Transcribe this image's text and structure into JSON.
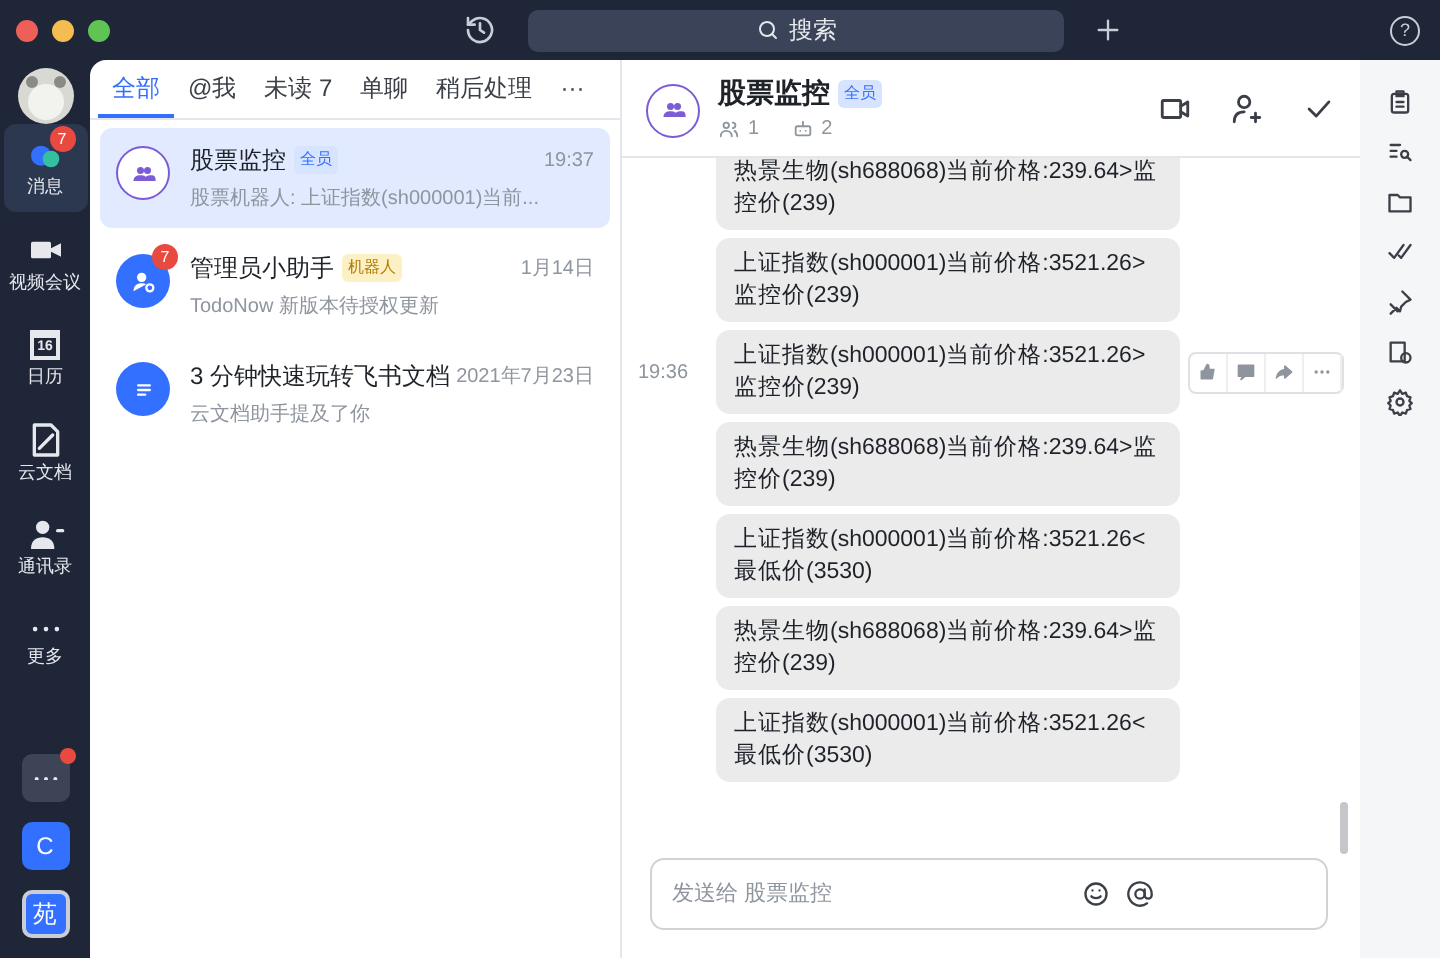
{
  "topbar": {
    "search": "搜索",
    "help": "?"
  },
  "rail": {
    "items": [
      {
        "label": "消息",
        "kind": "chat",
        "badge": "7",
        "selected": true
      },
      {
        "label": "视频会议",
        "kind": "video",
        "selected": false
      },
      {
        "label": "日历",
        "kind": "calendar",
        "day": "16",
        "selected": false
      },
      {
        "label": "云文档",
        "kind": "doc",
        "selected": false
      },
      {
        "label": "通讯录",
        "kind": "contacts",
        "selected": false
      },
      {
        "label": "更多",
        "kind": "more",
        "selected": false
      }
    ],
    "apps": [
      {
        "kind": "more",
        "dot": true
      },
      {
        "kind": "letter",
        "text": "C",
        "selected": false
      },
      {
        "kind": "letter",
        "text": "苑",
        "selected": true
      }
    ]
  },
  "tabs": [
    {
      "label": "全部",
      "selected": true
    },
    {
      "label": "@我",
      "selected": false
    },
    {
      "label": "未读 7",
      "selected": false
    },
    {
      "label": "单聊",
      "selected": false
    },
    {
      "label": "稍后处理",
      "selected": false
    },
    {
      "label": "···",
      "selected": false
    }
  ],
  "chats": [
    {
      "name": "股票监控",
      "tag": "全员",
      "time": "19:37",
      "preview": "股票机器人: 上证指数(sh000001)当前...",
      "kind": "group",
      "selected": true
    },
    {
      "name": "管理员小助手",
      "tag": "机器人",
      "time": "1月14日",
      "preview": "TodoNow 新版本待授权更新",
      "kind": "bot",
      "badge": "7",
      "selected": false
    },
    {
      "name": "3 分钟快速玩转飞书文档",
      "time": "2021年7月23日",
      "preview": "云文档助手提及了你",
      "kind": "doc",
      "selected": false
    }
  ],
  "chat": {
    "title": "股票监控",
    "tag": "全员",
    "members": "1",
    "bots": "2",
    "messages": [
      {
        "text": "热景生物(sh688068)当前价格:239.64>监控价(239)"
      },
      {
        "text": "上证指数(sh000001)当前价格:3521.26>监控价(239)"
      },
      {
        "text": "上证指数(sh000001)当前价格:3521.26>监控价(239)",
        "time": "19:36",
        "hovered": true
      },
      {
        "text": "热景生物(sh688068)当前价格:239.64>监控价(239)"
      },
      {
        "text": "上证指数(sh000001)当前价格:3521.26<最低价(3530)"
      },
      {
        "text": "热景生物(sh688068)当前价格:239.64>监控价(239)"
      },
      {
        "text": "上证指数(sh000001)当前价格:3521.26<最低价(3530)"
      }
    ],
    "input": {
      "placeholder": "发送给 股票监控"
    }
  }
}
